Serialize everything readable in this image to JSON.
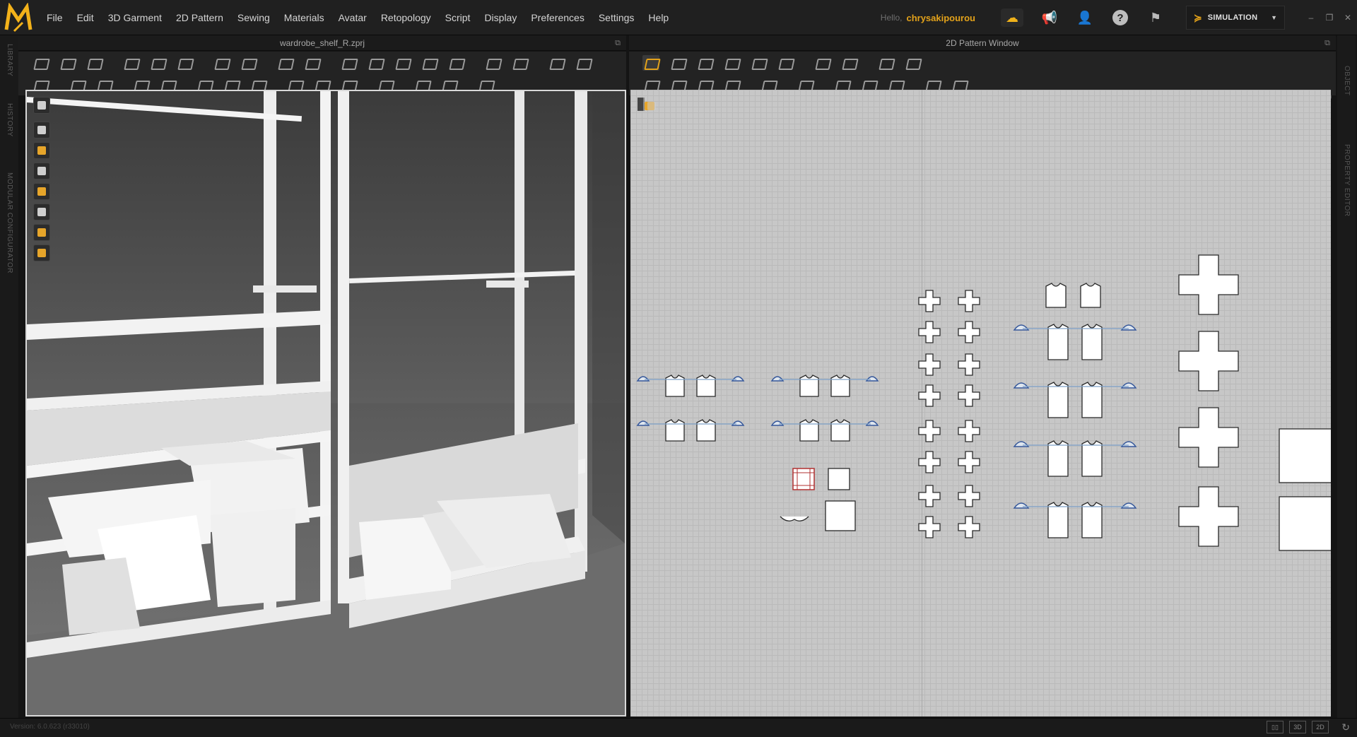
{
  "app": {
    "name": "Marvelous Designer",
    "logo_text": "M"
  },
  "menu": {
    "items": [
      "File",
      "Edit",
      "3D Garment",
      "2D Pattern",
      "Sewing",
      "Materials",
      "Avatar",
      "Retopology",
      "Script",
      "Display",
      "Preferences",
      "Settings",
      "Help"
    ]
  },
  "user": {
    "greeting": "Hello,",
    "name": "chrysakipourou"
  },
  "mode": {
    "label": "SIMULATION"
  },
  "window_controls": [
    "–",
    "❐",
    "✕"
  ],
  "panels": {
    "left_title": "wardrobe_shelf_R.zprj",
    "right_title": "2D Pattern Window"
  },
  "side_tabs": {
    "left": [
      "LIBRARY",
      "HISTORY",
      "MODULAR CONFIGURATOR"
    ],
    "right": [
      "OBJECT BROWSER",
      "PROPERTY EDITOR"
    ]
  },
  "status": {
    "version": "Version: 6.0.623 (r33010)",
    "view_modes": [
      "▯▯",
      "3D",
      "2D"
    ]
  },
  "colors": {
    "accent": "#e3a21a",
    "seam_blue": "#35579a",
    "canvas_bg": "#c7c7c7"
  }
}
